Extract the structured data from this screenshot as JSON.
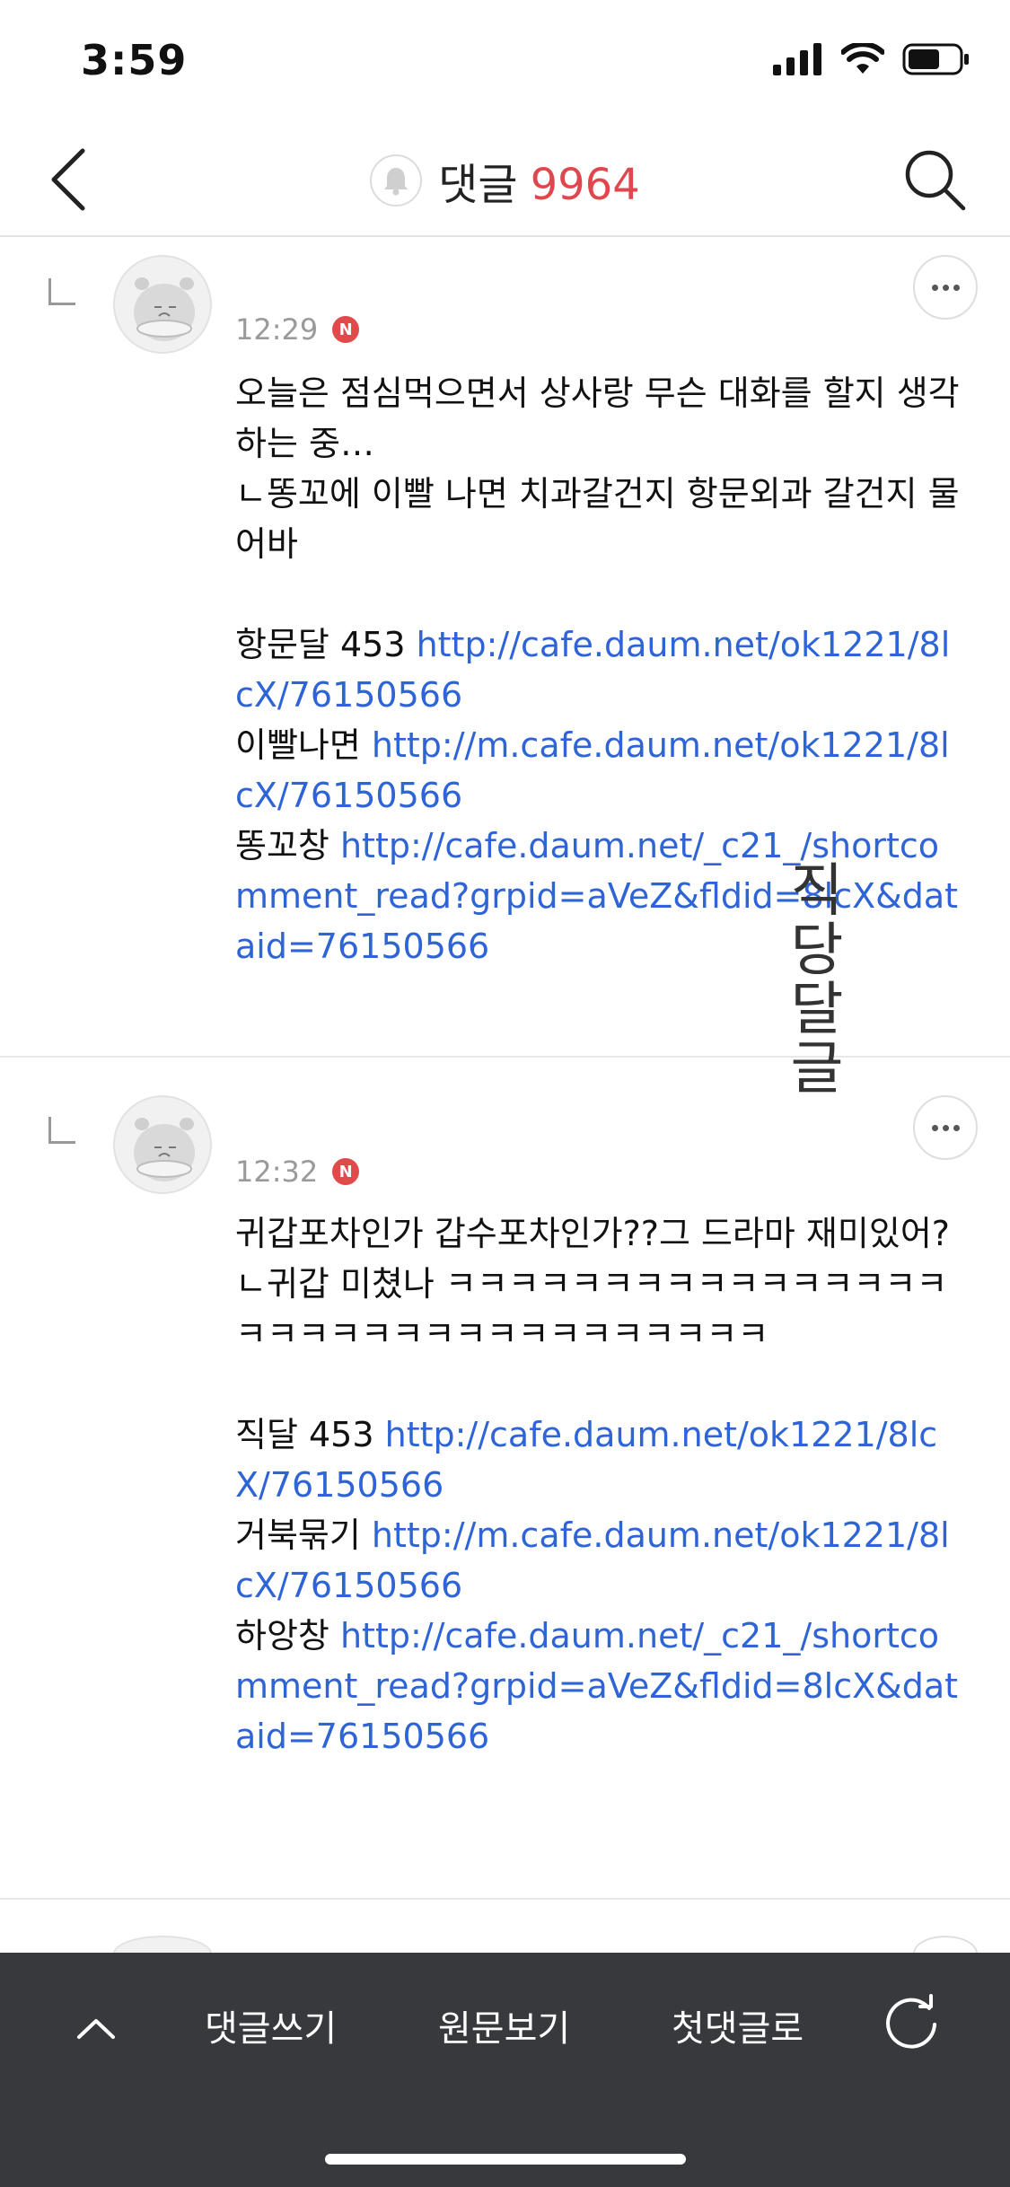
{
  "status_bar": {
    "time": "3:59"
  },
  "header": {
    "title": "댓글",
    "count": "9964"
  },
  "comments": [
    {
      "time": "12:29",
      "badge": "N",
      "lines": [
        {
          "text": "오늘은 점심먹으면서 상사랑 무슨 대화를 할지 생각하는 중…"
        },
        {
          "text": "ㄴ똥꼬에 이빨 나면 치과갈건지 항문외과 갈건지 물어바"
        },
        {
          "text": ""
        },
        {
          "label": "항문달 453 ",
          "link": "http://cafe.daum.net/ok1221/8lcX/76150566"
        },
        {
          "label": "이빨나면 ",
          "link": "http://m.cafe.daum.net/ok1221/8lcX/76150566"
        },
        {
          "label": "똥꼬창 ",
          "link": "http://cafe.daum.net/_c21_/shortcomment_read?grpid=aVeZ&fldid=8lcX&dataid=76150566"
        }
      ]
    },
    {
      "time": "12:32",
      "badge": "N",
      "lines": [
        {
          "text": "귀갑포차인가 갑수포차인가??그 드라마 재미있어?"
        },
        {
          "text": "ㄴ귀갑 미쳤나 ㅋㅋㅋㅋㅋㅋㅋㅋㅋㅋㅋㅋㅋㅋㅋㅋㅋㅋㅋㅋㅋㅋㅋㅋㅋㅋㅋㅋㅋㅋㅋㅋㅋ"
        },
        {
          "text": ""
        },
        {
          "label": "직달 453 ",
          "link": "http://cafe.daum.net/ok1221/8lcX/76150566"
        },
        {
          "label": "거북묶기 ",
          "link": "http://m.cafe.daum.net/ok1221/8lcX/76150566"
        },
        {
          "label": "하앙창 ",
          "link": "http://cafe.daum.net/_c21_/shortcomment_read?grpid=aVeZ&fldid=8lcX&dataid=76150566"
        }
      ]
    }
  ],
  "overlay": "직당달글",
  "bottom_bar": {
    "write_label": "댓글쓰기",
    "original_label": "원문보기",
    "first_label": "첫댓글로"
  },
  "icons": [
    "signal-icon",
    "wifi-icon",
    "battery-icon",
    "back-arrow-icon",
    "bell-icon",
    "search-icon",
    "more-icon",
    "reply-icon",
    "avatar-icon",
    "chevron-up-icon",
    "refresh-icon"
  ]
}
